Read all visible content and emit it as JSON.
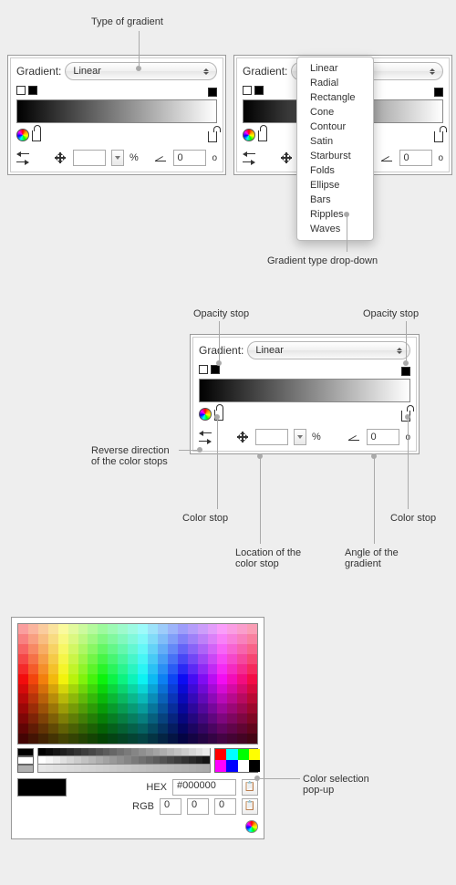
{
  "annotations": {
    "type_of_gradient": "Type of gradient",
    "gradient_type_dropdown": "Gradient type drop-down",
    "opacity_stop_left": "Opacity stop",
    "opacity_stop_right": "Opacity stop",
    "reverse_direction": "Reverse direction of the color stops",
    "color_stop_left": "Color stop",
    "color_stop_right": "Color stop",
    "location_of_stop": "Location of the color stop",
    "angle_of_gradient": "Angle of the gradient",
    "color_selection_popup": "Color selection pop-up"
  },
  "panel1": {
    "label": "Gradient:",
    "type": "Linear",
    "percent_symbol": "%",
    "angle_value": "0",
    "degree_symbol": "o",
    "location_value": ""
  },
  "panel2": {
    "label": "Gradient:",
    "dropdown_items": [
      "Linear",
      "Radial",
      "Rectangle",
      "Cone",
      "Contour",
      "Satin",
      "Starburst",
      "Folds",
      "Ellipse",
      "Bars",
      "Ripples",
      "Waves"
    ],
    "percent_symbol": "%",
    "angle_value": "0",
    "degree_symbol": "o"
  },
  "panel3": {
    "label": "Gradient:",
    "type": "Linear",
    "percent_symbol": "%",
    "angle_value": "0",
    "degree_symbol": "o",
    "location_value": ""
  },
  "color_picker": {
    "hex_label": "HEX",
    "hex_value": "#000000",
    "rgb_label": "RGB",
    "r": "0",
    "g": "0",
    "b": "0"
  }
}
